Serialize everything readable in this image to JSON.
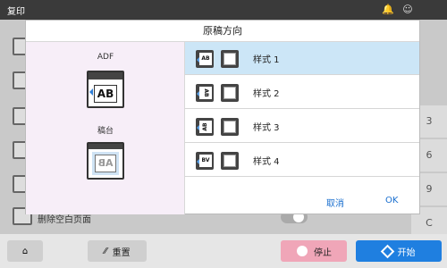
{
  "app": {
    "title": "复印"
  },
  "background": {
    "bottom_text": "删除空白页面",
    "right_numbers": [
      "3",
      "6",
      "9",
      "C"
    ]
  },
  "dialog": {
    "title": "原稿方向",
    "adf_label": "ADF",
    "platen_label": "稿台",
    "adf_icon_text": "AB",
    "platen_icon_text": "AB",
    "options": [
      {
        "label": "样式 1",
        "icon_text": "AB",
        "selected": true
      },
      {
        "label": "样式 2",
        "icon_text": "AB",
        "selected": false
      },
      {
        "label": "样式 3",
        "icon_text": "AB",
        "selected": false
      },
      {
        "label": "样式 4",
        "icon_text": "BV",
        "selected": false
      }
    ],
    "cancel_label": "取消",
    "ok_label": "OK"
  },
  "bottom_bar": {
    "reset_label": "重置",
    "stop_label": "停止",
    "start_label": "开始"
  },
  "colors": {
    "selected_row": "#cce6f7",
    "start_button": "#1f7fe0",
    "stop_button": "#f0a6b8",
    "link": "#1a6fcf"
  }
}
